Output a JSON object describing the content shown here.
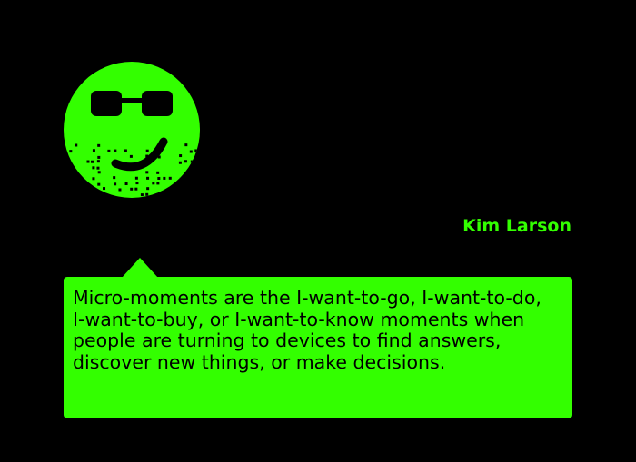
{
  "colors": {
    "background": "#000000",
    "accent": "#33ff00",
    "text_dark": "#000000"
  },
  "avatar": {
    "icon": "smiley-face-with-sunglasses-and-stubble-icon"
  },
  "author": {
    "name": "Kim Larson"
  },
  "quote": {
    "text": "Micro-moments are the I-want-to-go, I-want-to-do, I-want-to-buy, or I-want-to-know moments when people are turning to devices to find answers, discover new things, or make decisions."
  }
}
